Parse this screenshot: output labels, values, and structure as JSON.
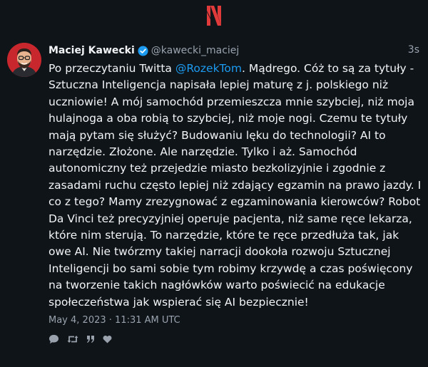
{
  "tweet": {
    "author_name": "Maciej Kawecki",
    "handle": "@kawecki_maciej",
    "relative_time": "3s",
    "text_before_mention": "Po przeczytaniu Twitta ",
    "mention": "@RozekTom",
    "text_after_mention": ". Mądrego. Cóż to są za tytuły - Sztuczna Inteligencja napisała lepiej maturę z j. polskiego niż uczniowie! A mój samochód przemieszcza mnie szybciej, niż moja hulajnoga a oba robią to szybciej, niż moje nogi. Czemu te tytuły mają pytam się służyć? Budowaniu lęku do technologii? AI to narzędzie. Złożone. Ale narzędzie. Tylko i aż. Samochód autonomiczny też przejedzie miasto bezkolizyjnie i zgodnie z zasadami ruchu często lepiej niż zdający egzamin na prawo jazdy. I co z tego? Mamy zrezygnować z egzaminowania kierowców? Robot Da Vinci też precyzyjniej operuje pacjenta, niż same ręce lekarza, które nim sterują. To narzędzie, które te ręce przedłuża tak, jak owe AI. Nie twórzmy takiej narracji dookoła rozwoju Sztucznej Inteligencji bo sami sobie tym robimy krzywdę a czas poświęcony na tworzenie takich nagłówków warto poświecić na edukacje społeczeństwa jak wspierać się AI bezpiecznie!",
    "date": "May 4, 2023 · 11:31 AM UTC"
  },
  "icons": {
    "logo": "nitter-logo-icon",
    "verified": "verified-badge-icon",
    "actions": [
      "reply-icon",
      "retweet-icon",
      "quote-icon",
      "like-icon"
    ]
  },
  "colors": {
    "background": "#0f1419",
    "text": "#f2f4f6",
    "muted": "#9aa3ad",
    "mention": "#1d9bf0",
    "logo": "#e13a3a",
    "verified": "#1d9bf0"
  }
}
